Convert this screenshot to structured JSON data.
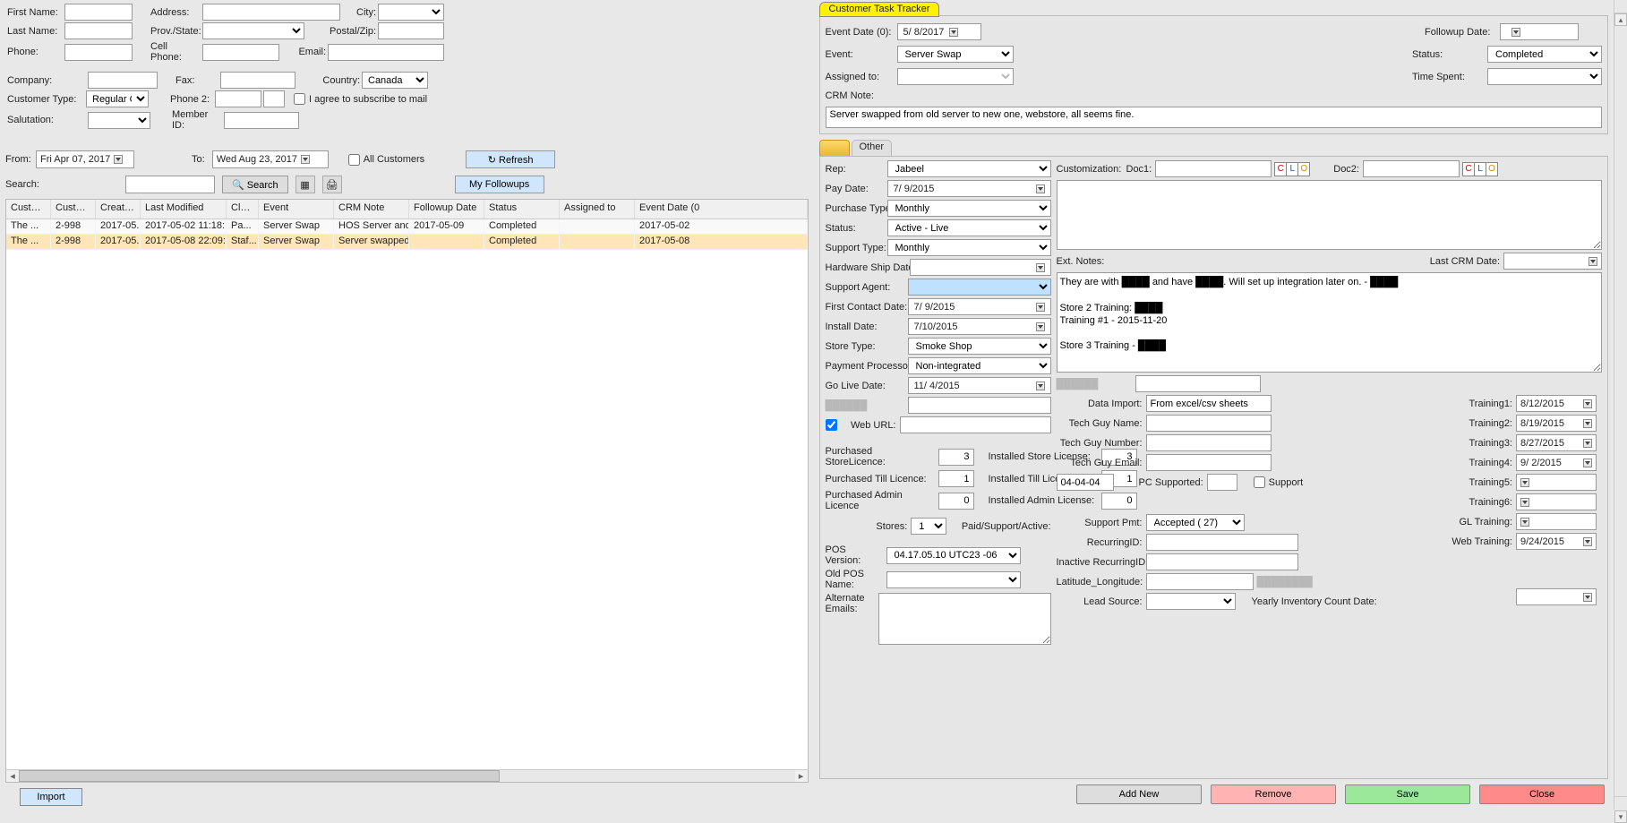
{
  "customer": {
    "firstName": "",
    "lastName": "",
    "phone": "",
    "company": "",
    "customerType": "Regular Custo",
    "salutation": "",
    "address": "",
    "provState": "",
    "cellPhone": "",
    "fax": "",
    "phone2": "",
    "memberId": "",
    "city": "",
    "postalZip": "",
    "email": "",
    "country": "Canada",
    "subscribe": false
  },
  "labels": {
    "firstName": "First Name:",
    "lastName": "Last Name:",
    "phone": "Phone:",
    "company": "Company:",
    "customerType": "Customer Type:",
    "salutation": "Salutation:",
    "address": "Address:",
    "provState": "Prov./State:",
    "cellPhone": "Cell Phone:",
    "fax": "Fax:",
    "phone2": "Phone 2:",
    "memberId": "Member ID:",
    "city": "City:",
    "postalZip": "Postal/Zip:",
    "email": "Email:",
    "country": "Country:",
    "subscribe": "I agree to subscribe to mail",
    "from": "From:",
    "to": "To:",
    "allCustomers": "All Customers",
    "search": "Search:",
    "searchBtn": "Search",
    "refresh": "Refresh",
    "myFollowups": "My Followups",
    "import": "Import"
  },
  "filter": {
    "from": "Fri   Apr 07, 2017",
    "to": "Wed Aug 23, 2017",
    "allCustomers": false
  },
  "grid": {
    "columns": [
      "Custom...",
      "Custom...",
      "Created",
      "Last Modified",
      "Clerk",
      "Event",
      "CRM Note",
      "Followup Date",
      "Status",
      "Assigned to",
      "Event Date (0"
    ],
    "widths": [
      50,
      50,
      50,
      96,
      36,
      84,
      84,
      84,
      84,
      84,
      80
    ],
    "rows": [
      {
        "c0": "The ...",
        "c1": "2-998",
        "c2": "2017-05...",
        "c3": "2017-05-02 11:18:...",
        "c4": "Pa...",
        "c5": "Server Swap",
        "c6": "HOS Server and...",
        "c7": "2017-05-09",
        "c8": "Completed",
        "c9": "",
        "c10": "2017-05-02"
      },
      {
        "c0": "The ...",
        "c1": "2-998",
        "c2": "2017-05...",
        "c3": "2017-05-08 22:09:...",
        "c4": "Staf...",
        "c5": "Server Swap",
        "c6": "Server swapped...",
        "c7": "",
        "c8": "Completed",
        "c9": "",
        "c10": "2017-05-08"
      }
    ]
  },
  "task": {
    "tabTitle": "Customer Task Tracker",
    "eventDateLabel": "Event Date (0):",
    "eventDate": "5/ 8/2017",
    "eventLabel": "Event:",
    "event": "Server Swap",
    "assignedLabel": "Assigned to:",
    "assigned": "",
    "followupLabel": "Followup Date:",
    "followup": "",
    "statusLabel": "Status:",
    "status": "Completed",
    "timeSpentLabel": "Time Spent:",
    "timeSpent": "",
    "crmNoteLabel": "CRM Note:",
    "crmNote": "Server swapped from old server to new one, webstore, all seems fine."
  },
  "otherTab": "Other",
  "details": {
    "repLabel": "Rep:",
    "rep": "Jabeel",
    "payDateLabel": "Pay Date:",
    "payDate": "7/ 9/2015",
    "purchaseTypeLabel": "Purchase Type:",
    "purchaseType": "Monthly",
    "statusLabel": "Status:",
    "status": "Active - Live",
    "supportTypeLabel": "Support Type:",
    "supportType": "Monthly",
    "hwShipLabel": "Hardware Ship Date:",
    "hwShip": "",
    "supportAgentLabel": "Support Agent:",
    "supportAgent": "",
    "firstContactLabel": "First Contact Date:",
    "firstContact": "7/ 9/2015",
    "installDateLabel": "Install Date:",
    "installDate": "7/10/2015",
    "storeTypeLabel": "Store Type:",
    "storeType": "Smoke Shop",
    "paymentProcLabel": "Payment Processor:",
    "paymentProc": "Non-integrated",
    "goLiveLabel": "Go Live Date:",
    "goLive": "11/ 4/2015",
    "customizationLabel": "Customization:",
    "doc1Label": "Doc1:",
    "doc2Label": "Doc2:",
    "extNotesLabel": "Ext. Notes:",
    "extNotes": "They are with ████ and have ████. Will set up integration later on. - ████\n\nStore 2 Training: ████\nTraining #1 - 2015-11-20\n\nStore 3 Training - ████",
    "lastCrmDateLabel": "Last CRM Date:",
    "lastCrmDate": "",
    "webUrlLabel": "Web URL:",
    "webUrl": "",
    "purchasedStoreLabel": "Purchased StoreLicence:",
    "purchasedStore": "3",
    "purchasedTillLabel": "Purchased Till Licence:",
    "purchasedTill": "1",
    "purchasedAdminLabel": "Purchased Admin Licence",
    "purchasedAdmin": "0",
    "installedStoreLabel": "Installed Store License:",
    "installedStore": "3",
    "installedTillLabel": "Installed Till License:",
    "installedTill": "1",
    "installedAdminLabel": "Installed Admin License:",
    "installedAdmin": "0",
    "storesLabel": "Stores:",
    "stores": "1",
    "paidLabel": "Paid/Support/Active:",
    "paid": "04-04-04",
    "pcSupportedLabel": "PC Supported:",
    "supportCheckLabel": "Support",
    "posVersionLabel": "POS Version:",
    "posVersion": "04.17.05.10 UTC23 -06",
    "oldPosLabel": "Old POS Name:",
    "altEmailsLabel": "Alternate Emails:",
    "dataImportLabel": "Data Import:",
    "dataImport": "From excel/csv sheets",
    "techGuyNameLabel": "Tech Guy Name:",
    "techGuyNumberLabel": "Tech Guy Number:",
    "techGuyEmailLabel": "Tech Guy Email:",
    "supportPmtLabel": "Support Pmt:",
    "supportPmt": "Accepted ( 27)",
    "recurringIdLabel": "RecurringID:",
    "inactiveRecurringLabel": "Inactive RecurringID:",
    "latlngLabel": "Latitude_Longitude:",
    "leadSourceLabel": "Lead Source:",
    "yearlyInvLabel": "Yearly Inventory Count Date:",
    "training": {
      "t1Label": "Training1:",
      "t1": "8/12/2015",
      "t2Label": "Training2:",
      "t2": "8/19/2015",
      "t3Label": "Training3:",
      "t3": "8/27/2015",
      "t4Label": "Training4:",
      "t4": "9/ 2/2015",
      "t5Label": "Training5:",
      "t5": "",
      "t6Label": "Training6:",
      "t6": "",
      "glLabel": "GL Training:",
      "gl": "",
      "webLabel": "Web Training:",
      "web": "9/24/2015"
    }
  },
  "footer": {
    "addNew": "Add New",
    "remove": "Remove",
    "save": "Save",
    "close": "Close"
  }
}
